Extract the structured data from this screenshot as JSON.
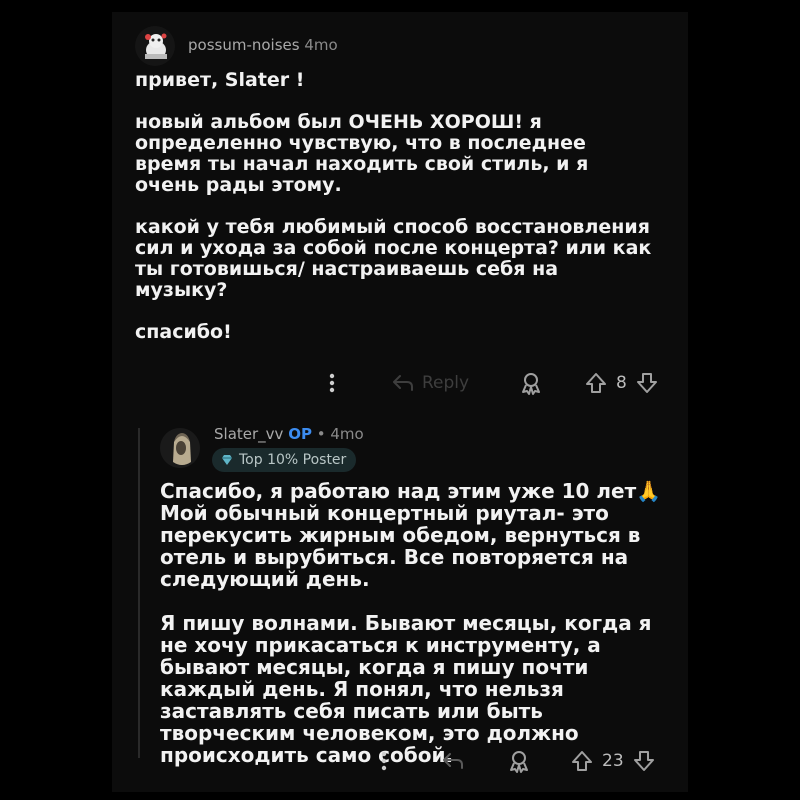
{
  "comment1": {
    "username": "possum-noises",
    "age": "4mo",
    "paragraphs": [
      "привет, Slater !",
      "новый альбом был ОЧЕНЬ ХОРОШ! я определенно чувствую, что в последнее время ты начал находить свой стиль, и я очень рады этому.",
      "какой у тебя любимый способ восстановления сил и ухода за собой после концерта? или как ты готовишься/ настраиваешь себя на музыку?",
      "спасибо!"
    ],
    "reply_label": "Reply",
    "votes": "8"
  },
  "comment2": {
    "username": "Slater_vv",
    "op": "OP",
    "separator": "•",
    "age": "4mo",
    "badge": "Top 10% Poster",
    "paragraphs": [
      "Спасибо, я работаю над этим уже 10 лет🙏 Мой обычный концертный риутал- это перекусить жирным обедом, вернуться в отель и вырубиться. Все повторяется на следующий день.",
      "Я пишу волнами. Бывают месяцы, когда я не хочу прикасаться к инструменту, а бывают месяцы, когда я пишу почти каждый день. Я понял, что нельзя заставлять себя писать или быть творческим человеком, это должно происходить само собой."
    ],
    "votes": "23"
  }
}
